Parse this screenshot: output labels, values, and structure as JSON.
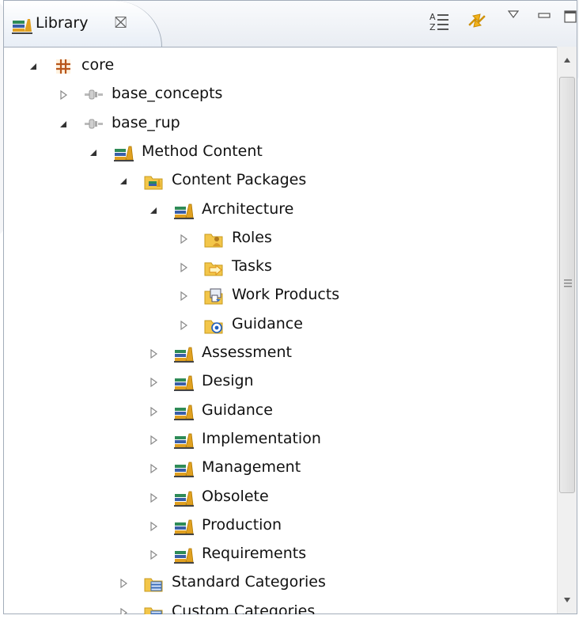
{
  "tab": {
    "title": "Library",
    "close_glyph": "⛝"
  },
  "toolbar": {
    "sort_icon": "sort-alpha-icon",
    "link_icon": "link-editor-icon",
    "menu_icon": "view-menu-icon",
    "minimize_icon": "minimize-icon",
    "maximize_icon": "maximize-icon"
  },
  "tree": [
    {
      "label": "core",
      "icon": "plugin-grid-icon",
      "expanded": true
    },
    {
      "label": "base_concepts",
      "icon": "plugin-icon",
      "expanded": false
    },
    {
      "label": "base_rup",
      "icon": "plugin-icon",
      "expanded": true
    },
    {
      "label": "Method Content",
      "icon": "books-icon",
      "expanded": true
    },
    {
      "label": "Content Packages",
      "icon": "folder-books-icon",
      "expanded": true
    },
    {
      "label": "Architecture",
      "icon": "books-icon",
      "expanded": true
    },
    {
      "label": "Roles",
      "icon": "folder-roles-icon",
      "expanded": false
    },
    {
      "label": "Tasks",
      "icon": "folder-tasks-icon",
      "expanded": false
    },
    {
      "label": "Work Products",
      "icon": "folder-workproducts-icon",
      "expanded": false
    },
    {
      "label": "Guidance",
      "icon": "folder-guidance-icon",
      "expanded": false
    },
    {
      "label": "Assessment",
      "icon": "books-icon",
      "expanded": false
    },
    {
      "label": "Design",
      "icon": "books-icon",
      "expanded": false
    },
    {
      "label": "Guidance",
      "icon": "books-icon",
      "expanded": false
    },
    {
      "label": "Implementation",
      "icon": "books-icon",
      "expanded": false
    },
    {
      "label": "Management",
      "icon": "books-icon",
      "expanded": false
    },
    {
      "label": "Obsolete",
      "icon": "books-icon",
      "expanded": false
    },
    {
      "label": "Production",
      "icon": "books-icon",
      "expanded": false
    },
    {
      "label": "Requirements",
      "icon": "books-icon",
      "expanded": false
    },
    {
      "label": "Standard Categories",
      "icon": "folder-categories-icon",
      "expanded": false
    },
    {
      "label": "Custom Categories",
      "icon": "folder-categories-icon",
      "expanded": false
    }
  ],
  "colors": {
    "border": "#a3adba",
    "books_green": "#2e8b57",
    "books_orange": "#e0a020",
    "books_blue": "#3a5fa8",
    "folder": "#f3c64a"
  }
}
